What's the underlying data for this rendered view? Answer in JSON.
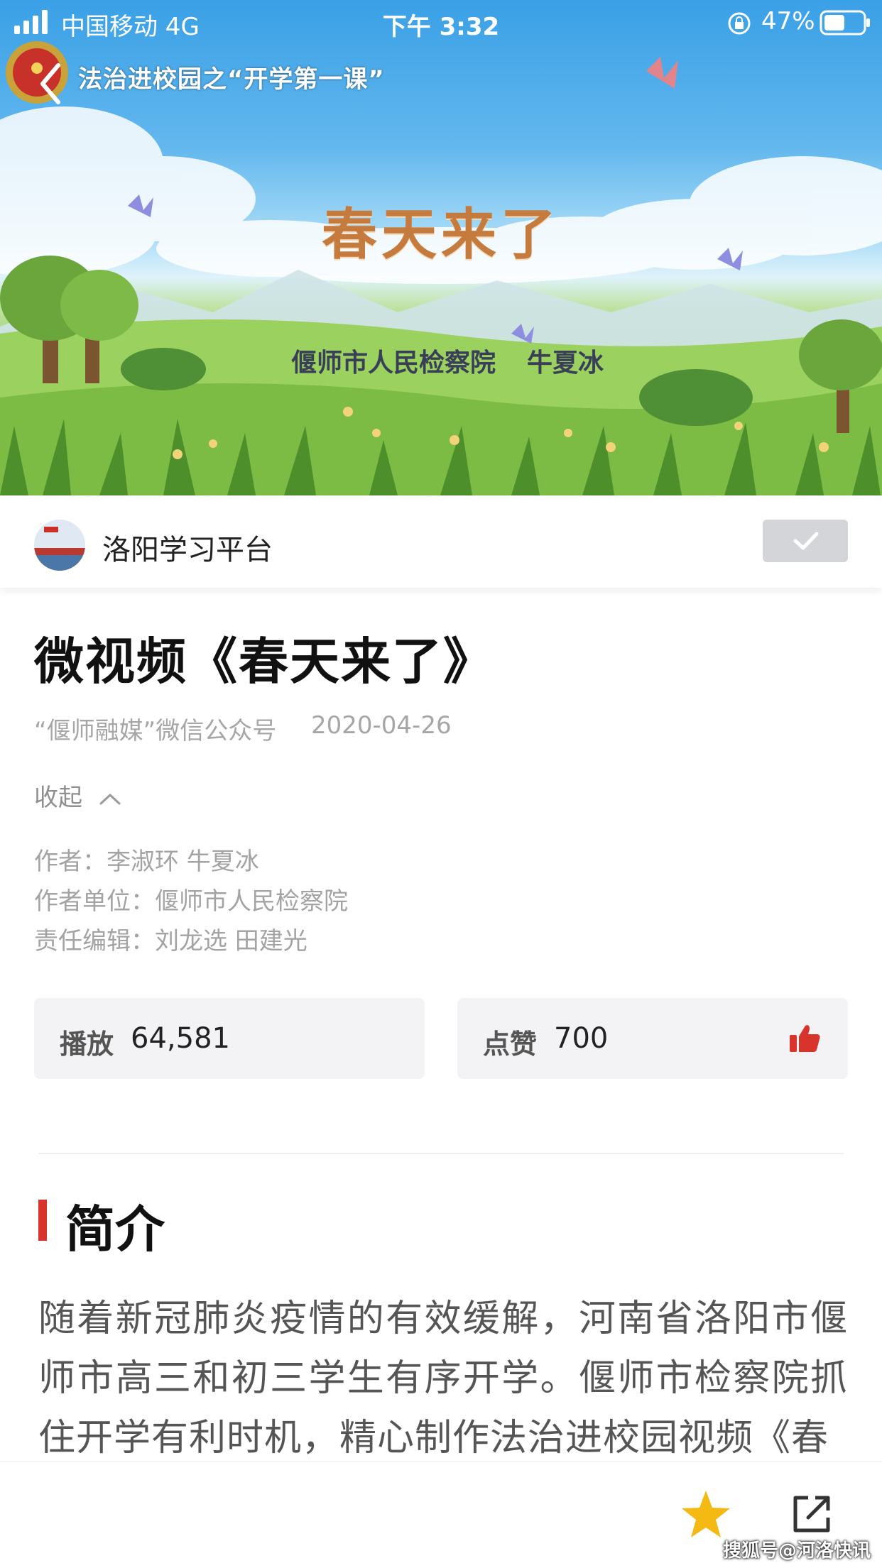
{
  "status_bar": {
    "carrier": "中国移动  4G",
    "time": "下午 3:32",
    "battery": "47%"
  },
  "video": {
    "title": "法治进校园之“开学第一课”",
    "main_text": "春天来了",
    "org": "偃师市人民检察院",
    "person": "牛夏冰"
  },
  "channel": {
    "name": "洛阳学习平台"
  },
  "article": {
    "title": "微视频《春天来了》",
    "source": "“偃师融媒”微信公众号",
    "date": "2020-04-26",
    "collapse_label": "收起",
    "credits": [
      "作者：李淑环 牛夏冰",
      "作者单位：偃师市人民检察院",
      "责任编辑：刘龙选 田建光"
    ]
  },
  "stats": {
    "play_label": "播放",
    "play_value": "64,581",
    "like_label": "点赞",
    "like_value": "700"
  },
  "section": {
    "title": "简介",
    "body": "随着新冠肺炎疫情的有效缓解，河南省洛阳市偃师市高三和初三学生有序开学。偃师市检察院抓住开学有利时机，精心制作法治进校园视频《春"
  },
  "watermark": "搜狐号@河洛快讯",
  "colors": {
    "accent_red": "#d9342b",
    "star_yellow": "#f5b914",
    "follow_bg": "#d3d5d8"
  },
  "icons": {
    "back": "chevron-left-icon",
    "collapse": "chevron-up-icon",
    "like": "thumbs-up-icon",
    "favorite": "star-icon",
    "share": "share-icon",
    "follow": "check-icon"
  }
}
